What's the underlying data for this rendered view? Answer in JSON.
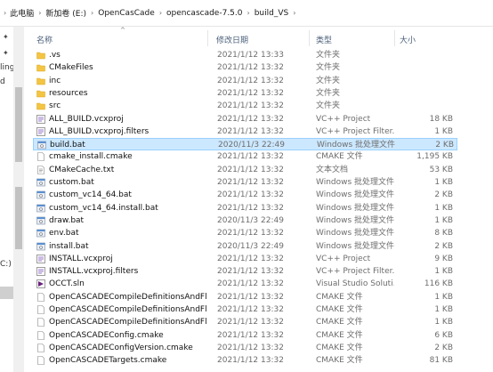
{
  "address": {
    "crumbs": [
      "此电脑",
      "新加卷 (E:)",
      "OpenCasCade",
      "opencascade-7.5.0",
      "build_VS"
    ]
  },
  "nav": {
    "fragments": [
      "ling",
      "d",
      "C:)"
    ]
  },
  "columns": {
    "name": "名称",
    "date": "修改日期",
    "type": "类型",
    "size": "大小"
  },
  "files": [
    {
      "name": ".vs",
      "date": "2021/1/12 13:33",
      "type": "文件夹",
      "size": "",
      "icon": "folder-icon"
    },
    {
      "name": "CMakeFiles",
      "date": "2021/1/12 13:32",
      "type": "文件夹",
      "size": "",
      "icon": "folder-icon"
    },
    {
      "name": "inc",
      "date": "2021/1/12 13:32",
      "type": "文件夹",
      "size": "",
      "icon": "folder-icon"
    },
    {
      "name": "resources",
      "date": "2021/1/12 13:32",
      "type": "文件夹",
      "size": "",
      "icon": "folder-icon"
    },
    {
      "name": "src",
      "date": "2021/1/12 13:32",
      "type": "文件夹",
      "size": "",
      "icon": "folder-icon"
    },
    {
      "name": "ALL_BUILD.vcxproj",
      "date": "2021/1/12 13:32",
      "type": "VC++ Project",
      "size": "18 KB",
      "icon": "vcxproj-icon"
    },
    {
      "name": "ALL_BUILD.vcxproj.filters",
      "date": "2021/1/12 13:32",
      "type": "VC++ Project Filter...",
      "size": "1 KB",
      "icon": "vcxproj-icon"
    },
    {
      "name": "build.bat",
      "date": "2020/11/3 22:49",
      "type": "Windows 批处理文件",
      "size": "2 KB",
      "icon": "bat-icon"
    },
    {
      "name": "cmake_install.cmake",
      "date": "2021/1/12 13:32",
      "type": "CMAKE 文件",
      "size": "1,195 KB",
      "icon": "file-icon"
    },
    {
      "name": "CMakeCache.txt",
      "date": "2021/1/12 13:32",
      "type": "文本文档",
      "size": "53 KB",
      "icon": "text-file-icon"
    },
    {
      "name": "custom.bat",
      "date": "2021/1/12 13:32",
      "type": "Windows 批处理文件",
      "size": "1 KB",
      "icon": "bat-icon"
    },
    {
      "name": "custom_vc14_64.bat",
      "date": "2021/1/12 13:32",
      "type": "Windows 批处理文件",
      "size": "2 KB",
      "icon": "bat-icon"
    },
    {
      "name": "custom_vc14_64.install.bat",
      "date": "2021/1/12 13:32",
      "type": "Windows 批处理文件",
      "size": "1 KB",
      "icon": "bat-icon"
    },
    {
      "name": "draw.bat",
      "date": "2020/11/3 22:49",
      "type": "Windows 批处理文件",
      "size": "1 KB",
      "icon": "bat-icon"
    },
    {
      "name": "env.bat",
      "date": "2021/1/12 13:32",
      "type": "Windows 批处理文件",
      "size": "8 KB",
      "icon": "bat-icon"
    },
    {
      "name": "install.bat",
      "date": "2020/11/3 22:49",
      "type": "Windows 批处理文件",
      "size": "2 KB",
      "icon": "bat-icon"
    },
    {
      "name": "INSTALL.vcxproj",
      "date": "2021/1/12 13:32",
      "type": "VC++ Project",
      "size": "9 KB",
      "icon": "vcxproj-icon"
    },
    {
      "name": "INSTALL.vcxproj.filters",
      "date": "2021/1/12 13:32",
      "type": "VC++ Project Filter...",
      "size": "1 KB",
      "icon": "vcxproj-icon"
    },
    {
      "name": "OCCT.sln",
      "date": "2021/1/12 13:32",
      "type": "Visual Studio Soluti...",
      "size": "116 KB",
      "icon": "sln-icon"
    },
    {
      "name": "OpenCASCADECompileDefinitionsAndFlags...",
      "date": "2021/1/12 13:32",
      "type": "CMAKE 文件",
      "size": "1 KB",
      "icon": "file-icon"
    },
    {
      "name": "OpenCASCADECompileDefinitionsAndFlags...",
      "date": "2021/1/12 13:32",
      "type": "CMAKE 文件",
      "size": "1 KB",
      "icon": "file-icon"
    },
    {
      "name": "OpenCASCADECompileDefinitionsAndFlags...",
      "date": "2021/1/12 13:32",
      "type": "CMAKE 文件",
      "size": "1 KB",
      "icon": "file-icon"
    },
    {
      "name": "OpenCASCADEConfig.cmake",
      "date": "2021/1/12 13:32",
      "type": "CMAKE 文件",
      "size": "6 KB",
      "icon": "file-icon"
    },
    {
      "name": "OpenCASCADEConfigVersion.cmake",
      "date": "2021/1/12 13:32",
      "type": "CMAKE 文件",
      "size": "2 KB",
      "icon": "file-icon"
    },
    {
      "name": "OpenCASCADETargets.cmake",
      "date": "2021/1/12 13:32",
      "type": "CMAKE 文件",
      "size": "81 KB",
      "icon": "file-icon"
    }
  ],
  "selected_index": 7,
  "colors": {
    "folder": "#f4c542",
    "selection": "#cce8ff",
    "header_text": "#4c607a"
  }
}
